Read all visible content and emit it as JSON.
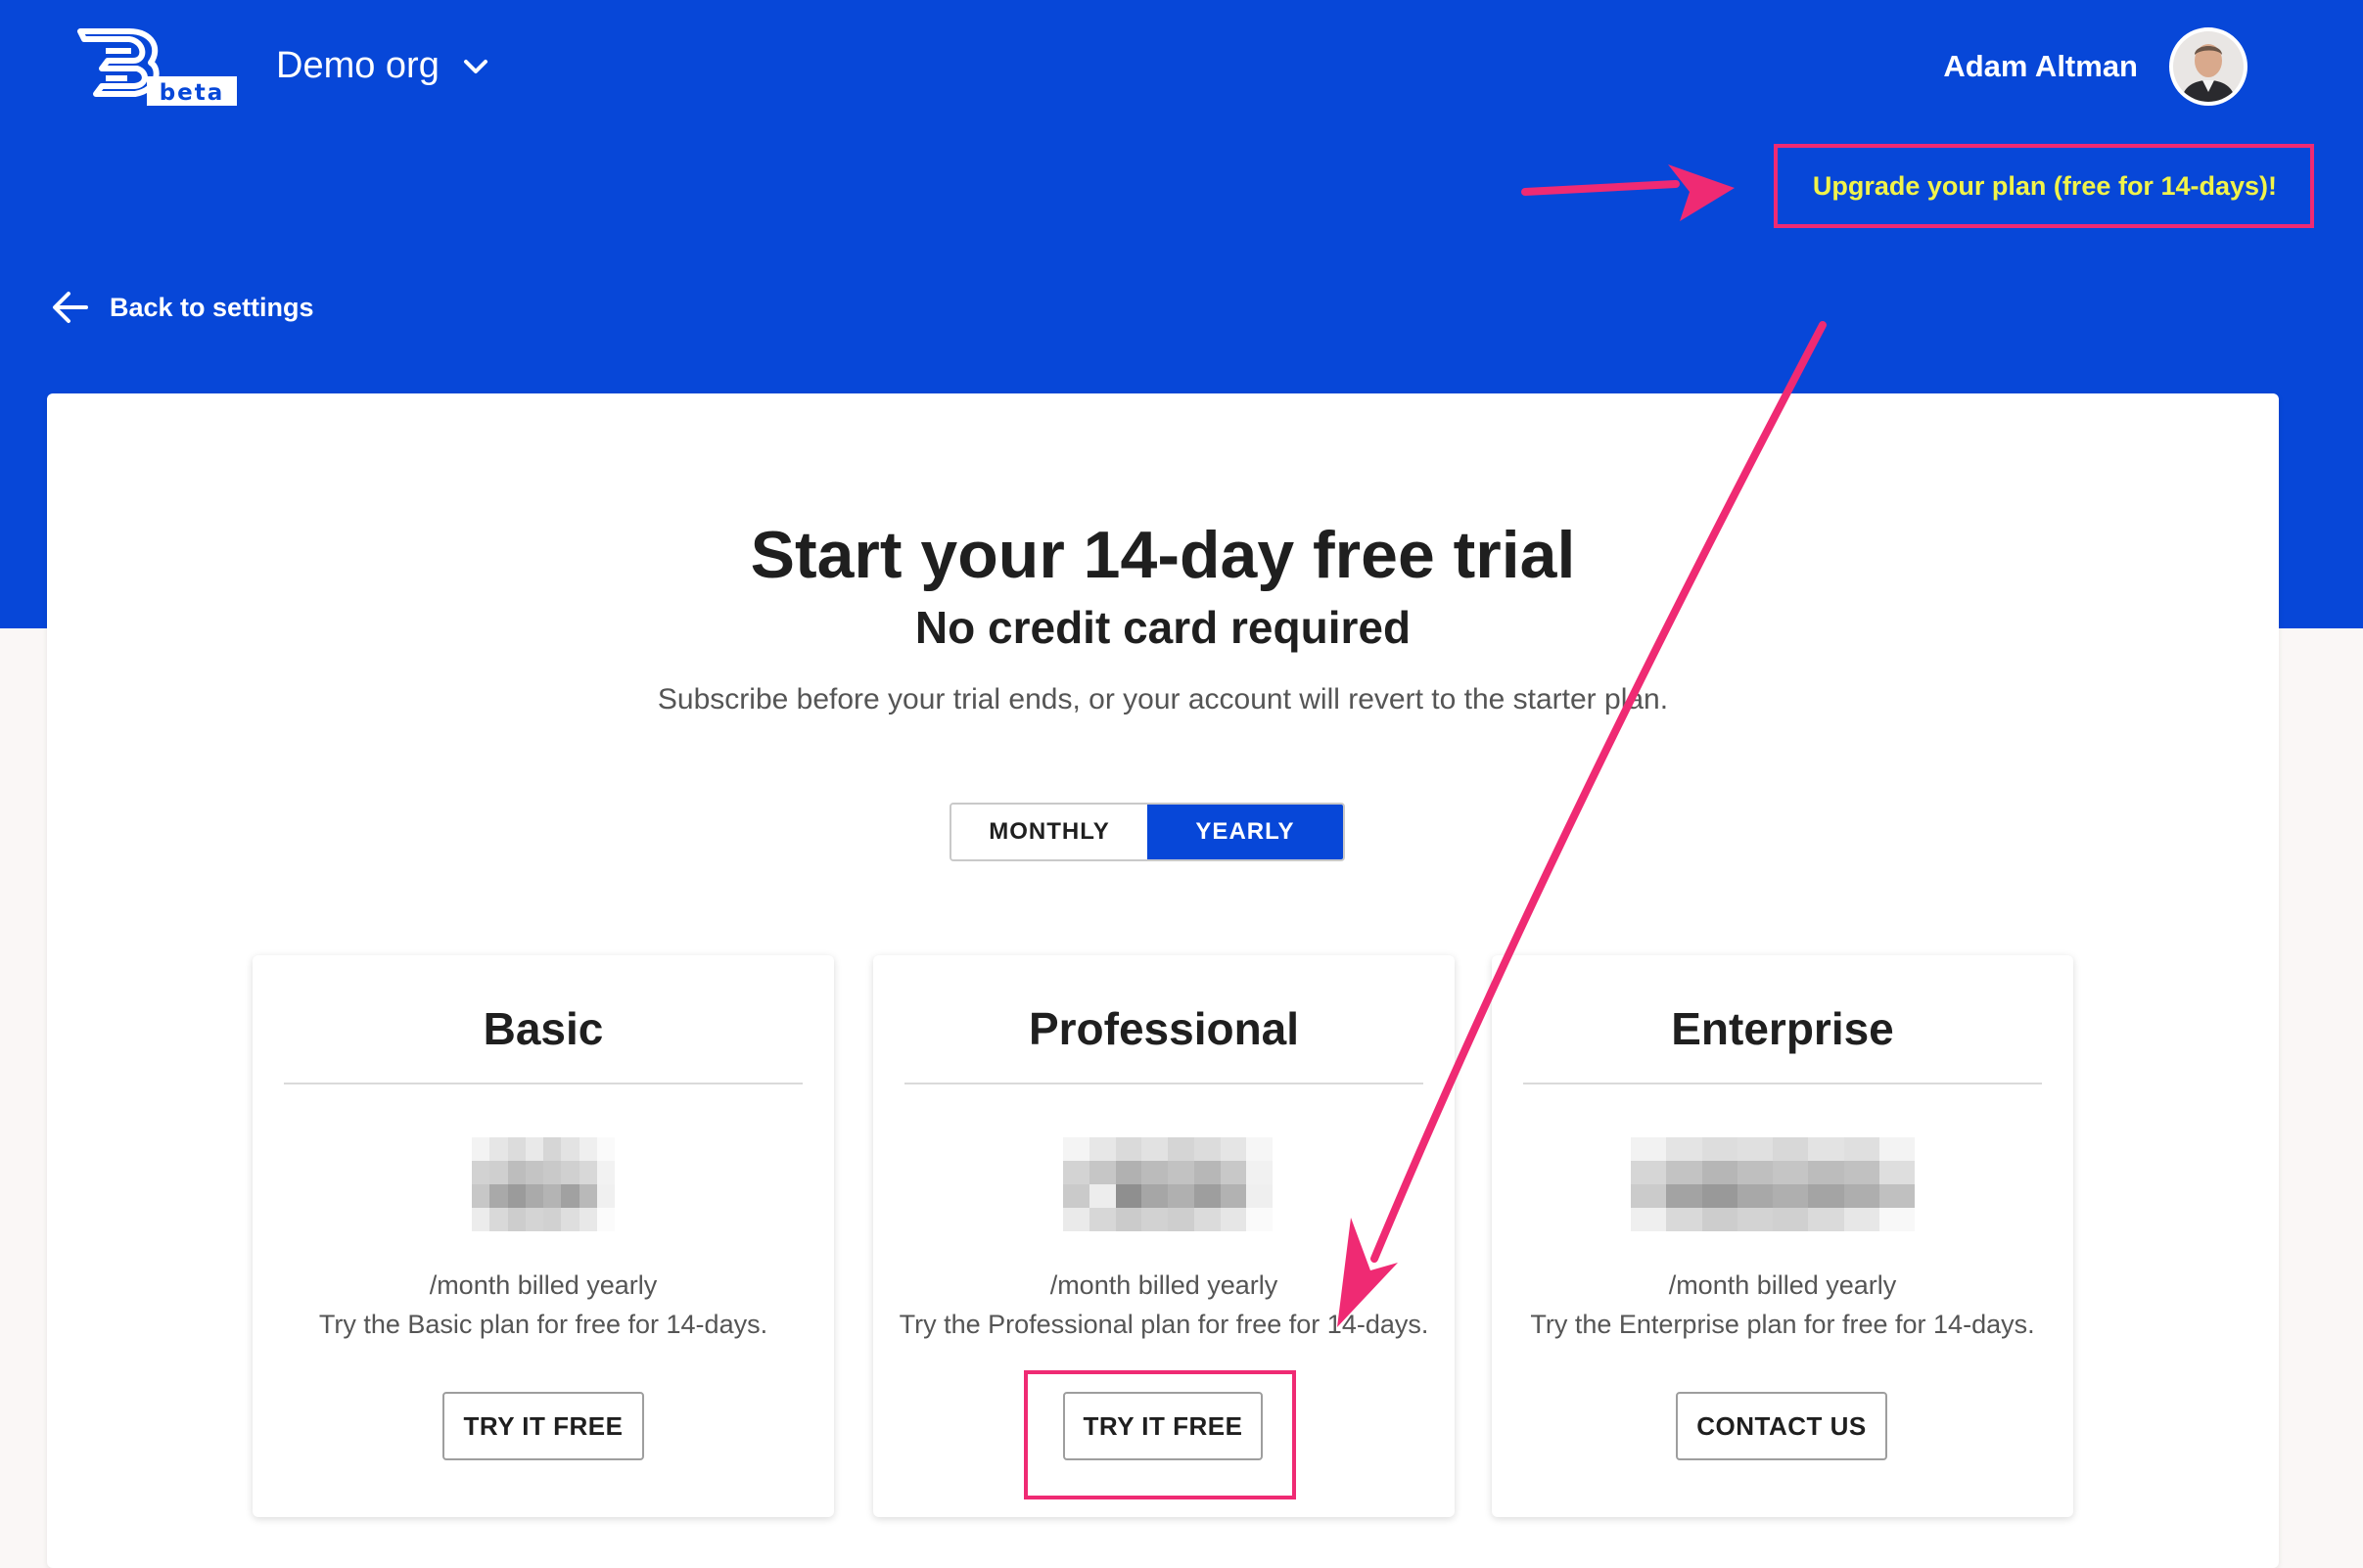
{
  "header": {
    "logo_badge": "beta",
    "org_name": "Demo org",
    "user_name": "Adam Altman",
    "upgrade_link": "Upgrade your plan (free for 14-days)!"
  },
  "nav": {
    "back_label": "Back to settings"
  },
  "hero": {
    "title": "Start your 14-day free trial",
    "subtitle": "No credit card required",
    "description": "Subscribe before your trial ends, or your account will revert to the starter plan."
  },
  "billing_toggle": {
    "monthly": "MONTHLY",
    "yearly": "YEARLY",
    "selected": "YEARLY"
  },
  "plans": [
    {
      "name": "Basic",
      "billing": "/month billed yearly",
      "trial": "Try the Basic plan for free for 14-days.",
      "button": "TRY IT FREE"
    },
    {
      "name": "Professional",
      "billing": "/month billed yearly",
      "trial": "Try the Professional plan for free for 14-days.",
      "button": "TRY IT FREE"
    },
    {
      "name": "Enterprise",
      "billing": "/month billed yearly",
      "trial": "Try the Enterprise plan for free for 14-days.",
      "button": "CONTACT US"
    }
  ],
  "colors": {
    "brand_blue": "#0747d8",
    "annotation_pink": "#ef2a73",
    "upgrade_yellow": "#f1f34a"
  },
  "icons": {
    "logo": "chat-bubble-logo",
    "org_dropdown": "chevron-down-icon",
    "back": "arrow-left-icon"
  }
}
